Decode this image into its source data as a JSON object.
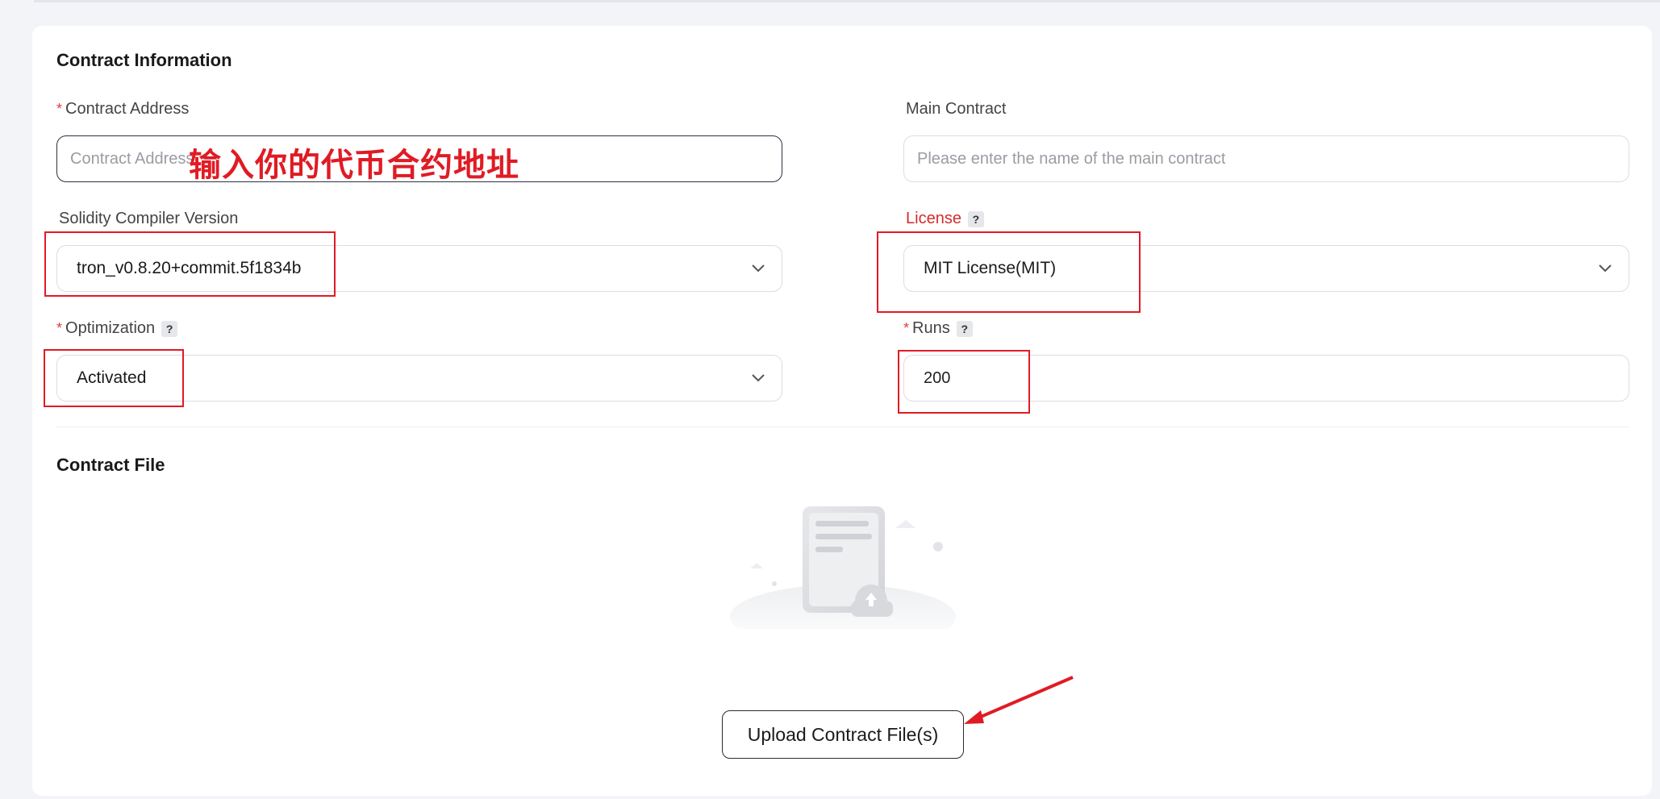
{
  "section_contract_info": "Contract Information",
  "fields": {
    "contract_address": {
      "label": "Contract Address",
      "required": "*",
      "value": "",
      "placeholder": "Contract Address"
    },
    "main_contract": {
      "label": "Main Contract",
      "value": "",
      "placeholder": "Please enter the name of the main contract"
    },
    "compiler_version": {
      "label": "Solidity Compiler Version",
      "value": "tron_v0.8.20+commit.5f1834b"
    },
    "license": {
      "label": "License",
      "help": "?",
      "value": "MIT License(MIT)"
    },
    "optimization": {
      "label": "Optimization",
      "required": "*",
      "help": "?",
      "value": "Activated"
    },
    "runs": {
      "label": "Runs",
      "required": "*",
      "help": "?",
      "value": "200"
    }
  },
  "section_contract_file": "Contract File",
  "upload_button_label": "Upload Contract File(s)",
  "annotation": {
    "text": "输入你的代币合约地址",
    "color": "#e01b24"
  },
  "colors": {
    "required_star": "#e23b3b",
    "license_label": "#d42b2b",
    "focus_border": "#2b3340"
  },
  "icons": {
    "select_chevron": "chevron-down-icon",
    "help": "question-icon",
    "upload_illustration": "document-upload-icon"
  }
}
